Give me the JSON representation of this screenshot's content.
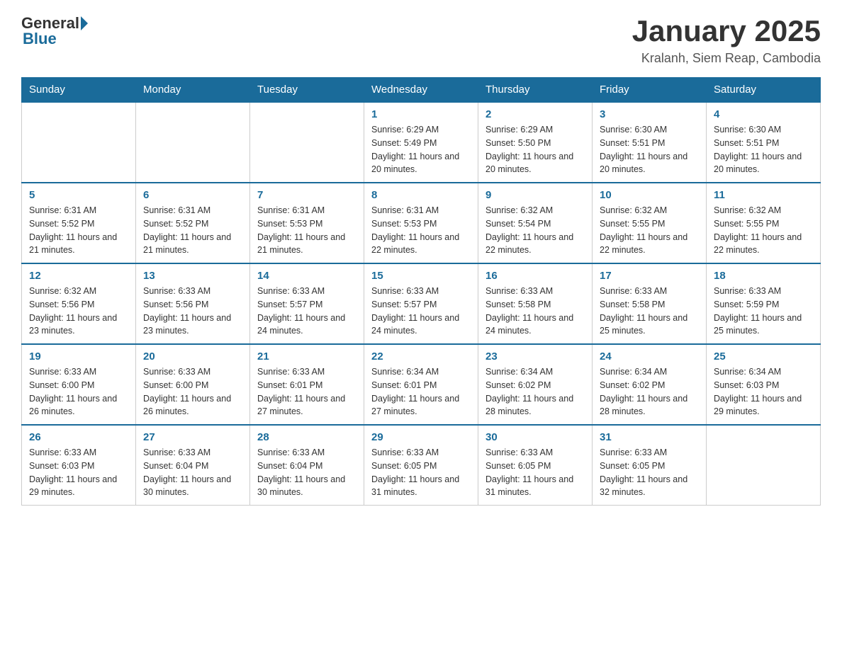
{
  "header": {
    "logo_general": "General",
    "logo_blue": "Blue",
    "month_title": "January 2025",
    "location": "Kralanh, Siem Reap, Cambodia"
  },
  "days_of_week": [
    "Sunday",
    "Monday",
    "Tuesday",
    "Wednesday",
    "Thursday",
    "Friday",
    "Saturday"
  ],
  "weeks": [
    [
      {
        "day": "",
        "info": ""
      },
      {
        "day": "",
        "info": ""
      },
      {
        "day": "",
        "info": ""
      },
      {
        "day": "1",
        "info": "Sunrise: 6:29 AM\nSunset: 5:49 PM\nDaylight: 11 hours and 20 minutes."
      },
      {
        "day": "2",
        "info": "Sunrise: 6:29 AM\nSunset: 5:50 PM\nDaylight: 11 hours and 20 minutes."
      },
      {
        "day": "3",
        "info": "Sunrise: 6:30 AM\nSunset: 5:51 PM\nDaylight: 11 hours and 20 minutes."
      },
      {
        "day": "4",
        "info": "Sunrise: 6:30 AM\nSunset: 5:51 PM\nDaylight: 11 hours and 20 minutes."
      }
    ],
    [
      {
        "day": "5",
        "info": "Sunrise: 6:31 AM\nSunset: 5:52 PM\nDaylight: 11 hours and 21 minutes."
      },
      {
        "day": "6",
        "info": "Sunrise: 6:31 AM\nSunset: 5:52 PM\nDaylight: 11 hours and 21 minutes."
      },
      {
        "day": "7",
        "info": "Sunrise: 6:31 AM\nSunset: 5:53 PM\nDaylight: 11 hours and 21 minutes."
      },
      {
        "day": "8",
        "info": "Sunrise: 6:31 AM\nSunset: 5:53 PM\nDaylight: 11 hours and 22 minutes."
      },
      {
        "day": "9",
        "info": "Sunrise: 6:32 AM\nSunset: 5:54 PM\nDaylight: 11 hours and 22 minutes."
      },
      {
        "day": "10",
        "info": "Sunrise: 6:32 AM\nSunset: 5:55 PM\nDaylight: 11 hours and 22 minutes."
      },
      {
        "day": "11",
        "info": "Sunrise: 6:32 AM\nSunset: 5:55 PM\nDaylight: 11 hours and 22 minutes."
      }
    ],
    [
      {
        "day": "12",
        "info": "Sunrise: 6:32 AM\nSunset: 5:56 PM\nDaylight: 11 hours and 23 minutes."
      },
      {
        "day": "13",
        "info": "Sunrise: 6:33 AM\nSunset: 5:56 PM\nDaylight: 11 hours and 23 minutes."
      },
      {
        "day": "14",
        "info": "Sunrise: 6:33 AM\nSunset: 5:57 PM\nDaylight: 11 hours and 24 minutes."
      },
      {
        "day": "15",
        "info": "Sunrise: 6:33 AM\nSunset: 5:57 PM\nDaylight: 11 hours and 24 minutes."
      },
      {
        "day": "16",
        "info": "Sunrise: 6:33 AM\nSunset: 5:58 PM\nDaylight: 11 hours and 24 minutes."
      },
      {
        "day": "17",
        "info": "Sunrise: 6:33 AM\nSunset: 5:58 PM\nDaylight: 11 hours and 25 minutes."
      },
      {
        "day": "18",
        "info": "Sunrise: 6:33 AM\nSunset: 5:59 PM\nDaylight: 11 hours and 25 minutes."
      }
    ],
    [
      {
        "day": "19",
        "info": "Sunrise: 6:33 AM\nSunset: 6:00 PM\nDaylight: 11 hours and 26 minutes."
      },
      {
        "day": "20",
        "info": "Sunrise: 6:33 AM\nSunset: 6:00 PM\nDaylight: 11 hours and 26 minutes."
      },
      {
        "day": "21",
        "info": "Sunrise: 6:33 AM\nSunset: 6:01 PM\nDaylight: 11 hours and 27 minutes."
      },
      {
        "day": "22",
        "info": "Sunrise: 6:34 AM\nSunset: 6:01 PM\nDaylight: 11 hours and 27 minutes."
      },
      {
        "day": "23",
        "info": "Sunrise: 6:34 AM\nSunset: 6:02 PM\nDaylight: 11 hours and 28 minutes."
      },
      {
        "day": "24",
        "info": "Sunrise: 6:34 AM\nSunset: 6:02 PM\nDaylight: 11 hours and 28 minutes."
      },
      {
        "day": "25",
        "info": "Sunrise: 6:34 AM\nSunset: 6:03 PM\nDaylight: 11 hours and 29 minutes."
      }
    ],
    [
      {
        "day": "26",
        "info": "Sunrise: 6:33 AM\nSunset: 6:03 PM\nDaylight: 11 hours and 29 minutes."
      },
      {
        "day": "27",
        "info": "Sunrise: 6:33 AM\nSunset: 6:04 PM\nDaylight: 11 hours and 30 minutes."
      },
      {
        "day": "28",
        "info": "Sunrise: 6:33 AM\nSunset: 6:04 PM\nDaylight: 11 hours and 30 minutes."
      },
      {
        "day": "29",
        "info": "Sunrise: 6:33 AM\nSunset: 6:05 PM\nDaylight: 11 hours and 31 minutes."
      },
      {
        "day": "30",
        "info": "Sunrise: 6:33 AM\nSunset: 6:05 PM\nDaylight: 11 hours and 31 minutes."
      },
      {
        "day": "31",
        "info": "Sunrise: 6:33 AM\nSunset: 6:05 PM\nDaylight: 11 hours and 32 minutes."
      },
      {
        "day": "",
        "info": ""
      }
    ]
  ]
}
